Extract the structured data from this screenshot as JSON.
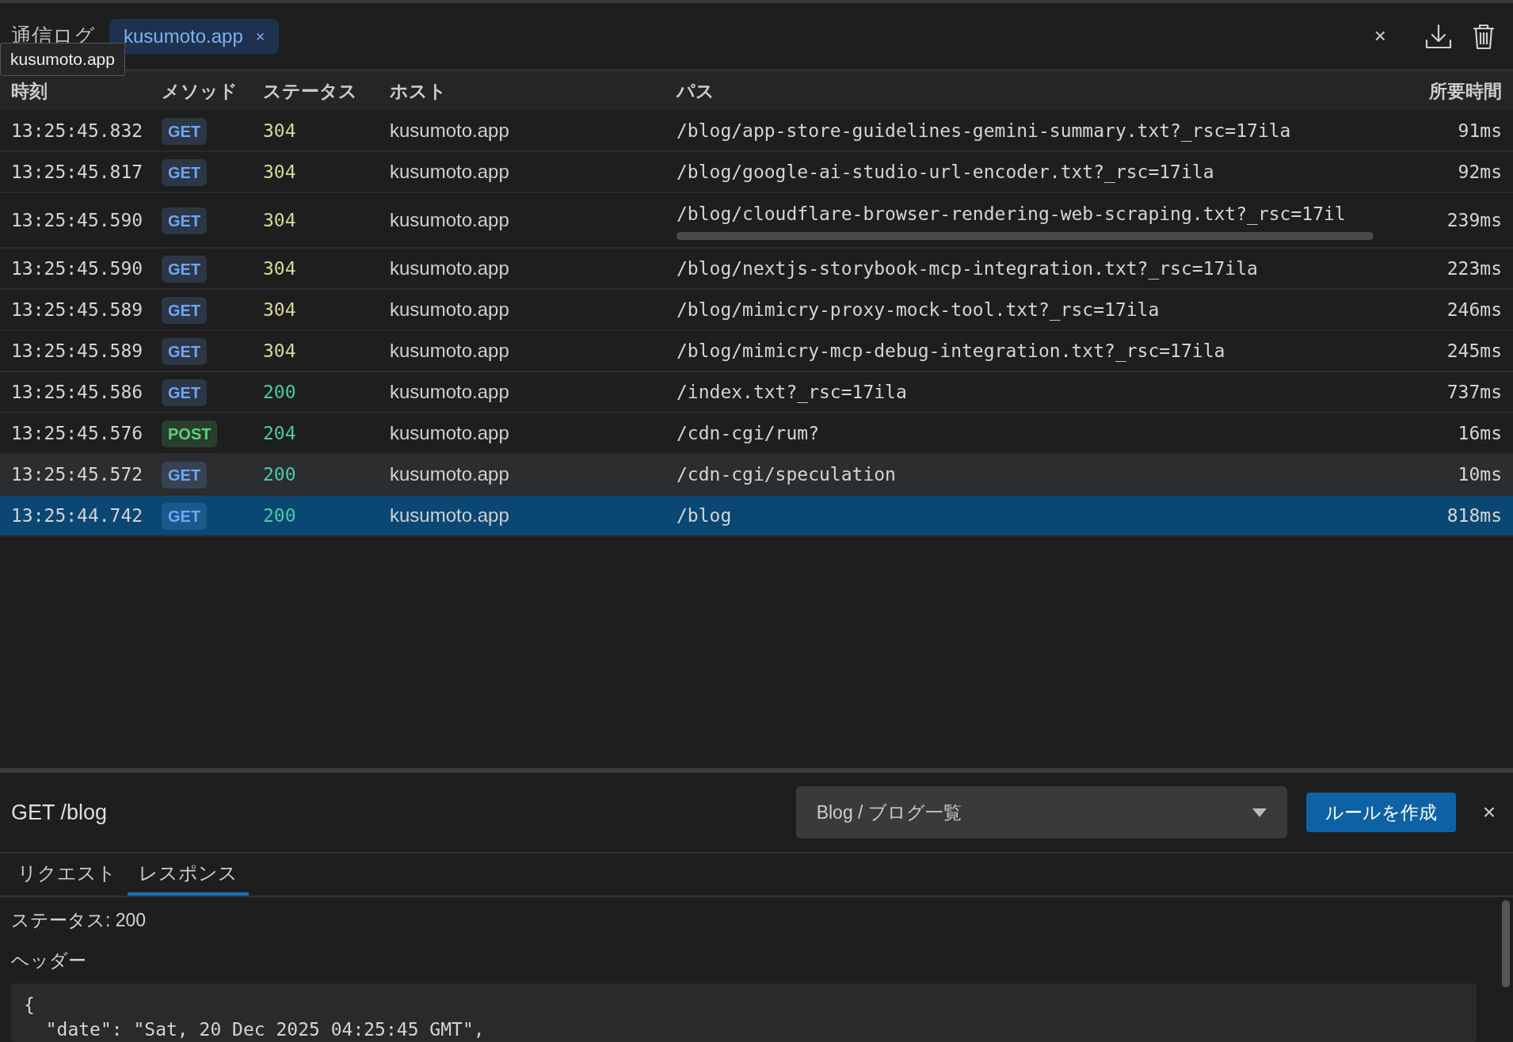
{
  "header": {
    "title": "通信ログ",
    "filter_chip": {
      "label": "kusumoto.app",
      "remove": "×"
    },
    "tooltip": "kusumoto.app",
    "clear": "×"
  },
  "table": {
    "columns": [
      "時刻",
      "メソッド",
      "ステータス",
      "ホスト",
      "パス",
      "所要時間"
    ],
    "rows": [
      {
        "time": "13:25:45.832",
        "method": {
          "label": "GET",
          "color": "#6ea6f5"
        },
        "status": {
          "label": "304",
          "color": "#d9d79c"
        },
        "host": "kusumoto.app",
        "path": "/blog/app-store-guidelines-gemini-summary.txt?_rsc=17ila",
        "h_scrollbar": false,
        "duration": "91ms",
        "hovered": false,
        "selected": false
      },
      {
        "time": "13:25:45.817",
        "method": {
          "label": "GET",
          "color": "#6ea6f5"
        },
        "status": {
          "label": "304",
          "color": "#d9d79c"
        },
        "host": "kusumoto.app",
        "path": "/blog/google-ai-studio-url-encoder.txt?_rsc=17ila",
        "h_scrollbar": false,
        "duration": "92ms",
        "hovered": false,
        "selected": false
      },
      {
        "time": "13:25:45.590",
        "method": {
          "label": "GET",
          "color": "#6ea6f5"
        },
        "status": {
          "label": "304",
          "color": "#d9d79c"
        },
        "host": "kusumoto.app",
        "path": "/blog/cloudflare-browser-rendering-web-scraping.txt?_rsc=17il",
        "h_scrollbar": true,
        "duration": "239ms",
        "hovered": false,
        "selected": false
      },
      {
        "time": "13:25:45.590",
        "method": {
          "label": "GET",
          "color": "#6ea6f5"
        },
        "status": {
          "label": "304",
          "color": "#d9d79c"
        },
        "host": "kusumoto.app",
        "path": "/blog/nextjs-storybook-mcp-integration.txt?_rsc=17ila",
        "h_scrollbar": false,
        "duration": "223ms",
        "hovered": false,
        "selected": false
      },
      {
        "time": "13:25:45.589",
        "method": {
          "label": "GET",
          "color": "#6ea6f5"
        },
        "status": {
          "label": "304",
          "color": "#d9d79c"
        },
        "host": "kusumoto.app",
        "path": "/blog/mimicry-proxy-mock-tool.txt?_rsc=17ila",
        "h_scrollbar": false,
        "duration": "246ms",
        "hovered": false,
        "selected": false
      },
      {
        "time": "13:25:45.589",
        "method": {
          "label": "GET",
          "color": "#6ea6f5"
        },
        "status": {
          "label": "304",
          "color": "#d9d79c"
        },
        "host": "kusumoto.app",
        "path": "/blog/mimicry-mcp-debug-integration.txt?_rsc=17ila",
        "h_scrollbar": false,
        "duration": "245ms",
        "hovered": false,
        "selected": false
      },
      {
        "time": "13:25:45.586",
        "method": {
          "label": "GET",
          "color": "#6ea6f5"
        },
        "status": {
          "label": "200",
          "color": "#4ec9a6"
        },
        "host": "kusumoto.app",
        "path": "/index.txt?_rsc=17ila",
        "h_scrollbar": false,
        "duration": "737ms",
        "hovered": false,
        "selected": false
      },
      {
        "time": "13:25:45.576",
        "method": {
          "label": "POST",
          "color": "#5cd17a"
        },
        "status": {
          "label": "204",
          "color": "#4ec9a6"
        },
        "host": "kusumoto.app",
        "path": "/cdn-cgi/rum?",
        "h_scrollbar": false,
        "duration": "16ms",
        "hovered": false,
        "selected": false
      },
      {
        "time": "13:25:45.572",
        "method": {
          "label": "GET",
          "color": "#6ea6f5"
        },
        "status": {
          "label": "200",
          "color": "#4ec9a6"
        },
        "host": "kusumoto.app",
        "path": "/cdn-cgi/speculation",
        "h_scrollbar": false,
        "duration": "10ms",
        "hovered": true,
        "selected": false
      },
      {
        "time": "13:25:44.742",
        "method": {
          "label": "GET",
          "color": "#6ea6f5"
        },
        "status": {
          "label": "200",
          "color": "#4ec9a6"
        },
        "host": "kusumoto.app",
        "path": "/blog",
        "h_scrollbar": false,
        "duration": "818ms",
        "hovered": false,
        "selected": true
      }
    ]
  },
  "detail": {
    "title": "GET /blog",
    "rule_select": {
      "value": "Blog / ブログ一覧"
    },
    "create_rule_button": "ルールを作成",
    "close": "×",
    "tabs": [
      {
        "label": "リクエスト",
        "selected": false
      },
      {
        "label": "レスポンス",
        "selected": true
      }
    ],
    "status_line": "ステータス: 200",
    "headers_label": "ヘッダー",
    "headers_code": [
      "{",
      "  \"date\": \"Sat, 20 Dec 2025 04:25:45 GMT\","
    ]
  }
}
